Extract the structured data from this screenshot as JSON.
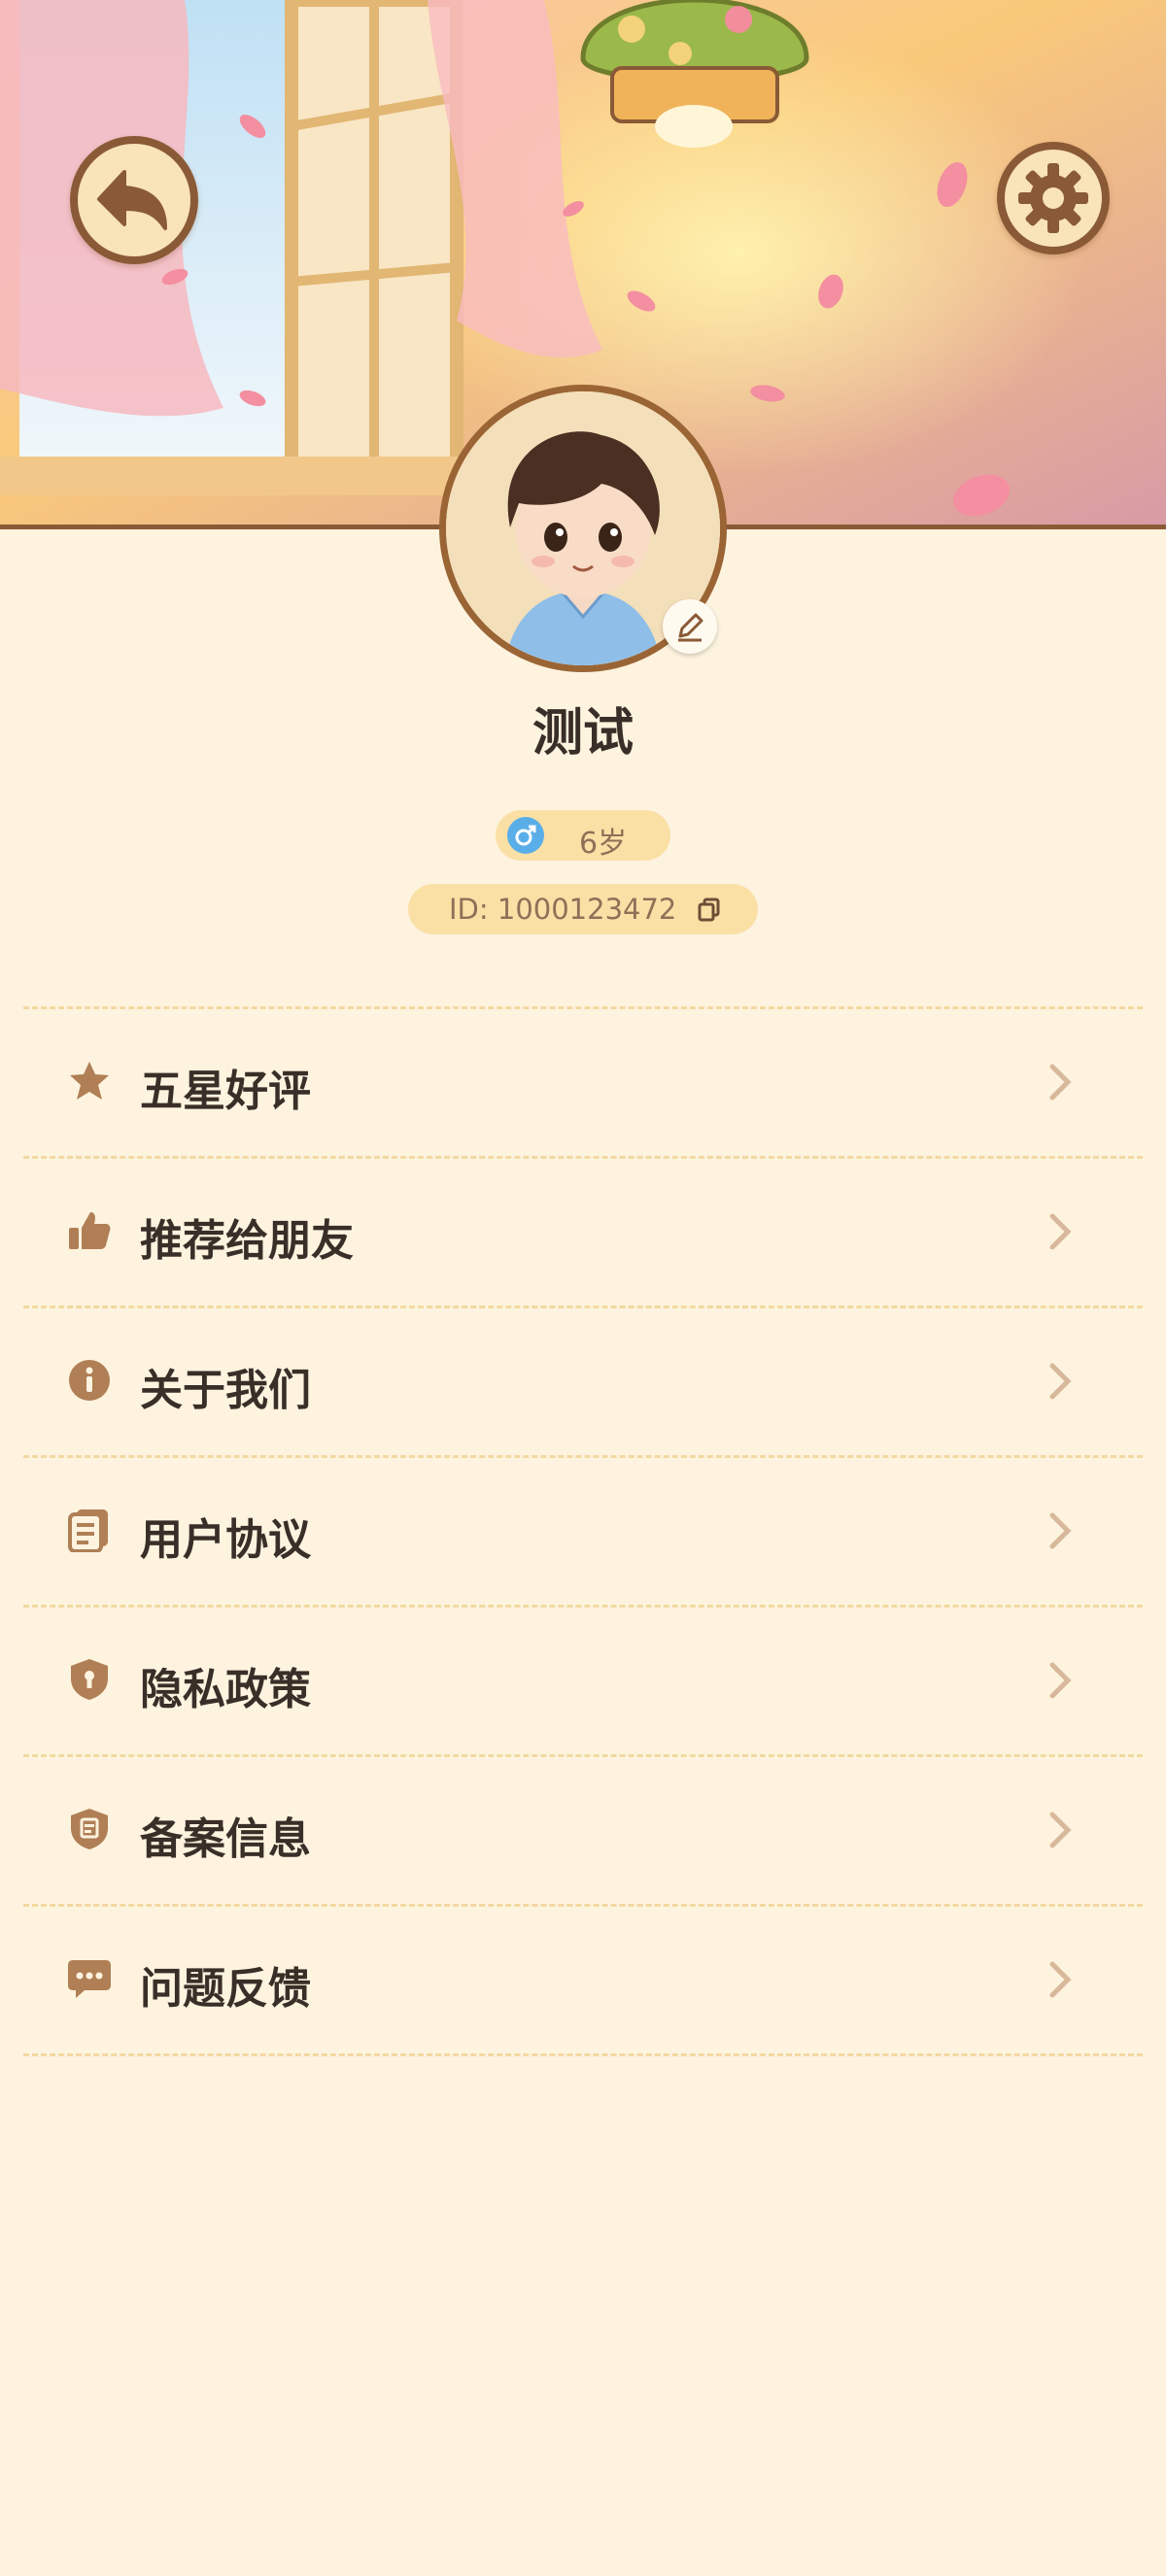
{
  "header": {
    "back_icon": "back-arrow-icon",
    "settings_icon": "gear-icon"
  },
  "profile": {
    "name": "测试",
    "age": "6岁",
    "gender_icon": "male-icon",
    "id_text": "ID: 1000123472",
    "copy_icon": "copy-icon",
    "edit_icon": "pencil-icon"
  },
  "menu": {
    "items": [
      {
        "label": "五星好评",
        "icon": "star-icon"
      },
      {
        "label": "推荐给朋友",
        "icon": "thumbs-up-icon"
      },
      {
        "label": "关于我们",
        "icon": "info-icon"
      },
      {
        "label": "用户协议",
        "icon": "document-icon"
      },
      {
        "label": "隐私政策",
        "icon": "shield-icon"
      },
      {
        "label": "备案信息",
        "icon": "badge-icon"
      },
      {
        "label": "问题反馈",
        "icon": "chat-icon"
      }
    ]
  },
  "colors": {
    "background": "#fdf3df",
    "accent_brown": "#8a5a36",
    "pill": "#fbe0a6",
    "divider": "#f2d9a0",
    "icon": "#b07f55"
  }
}
